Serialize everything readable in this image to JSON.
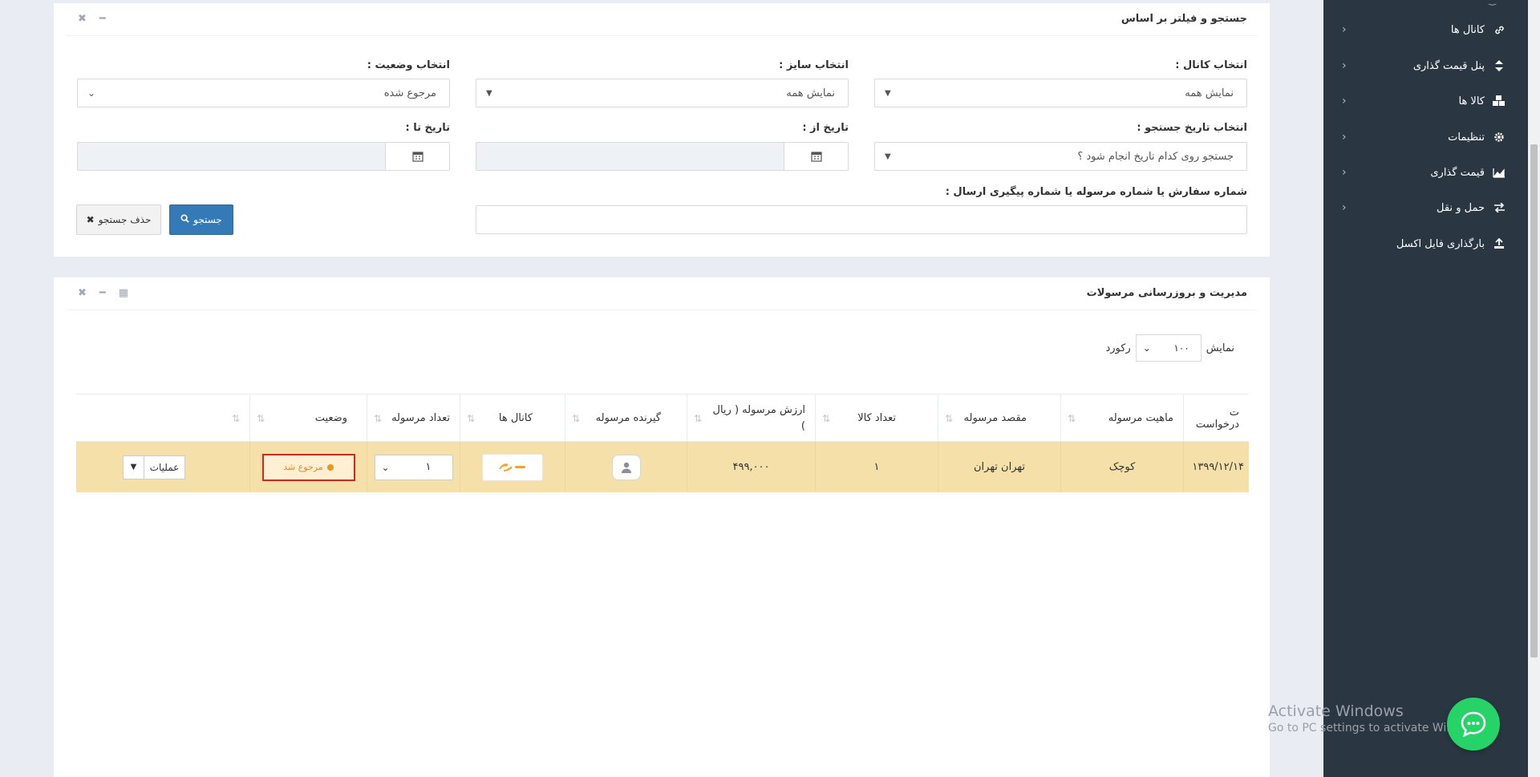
{
  "sidebar": {
    "items": [
      {
        "label": "کانال ها",
        "icon": "link-icon"
      },
      {
        "label": "پنل قیمت گذاری",
        "icon": "sort-icon"
      },
      {
        "label": "کالا ها",
        "icon": "cubes-icon"
      },
      {
        "label": "تنظیمات",
        "icon": "gear-icon"
      },
      {
        "label": "قیمت گذاری",
        "icon": "area-chart-icon"
      },
      {
        "label": "حمل و نقل",
        "icon": "exchange-icon"
      },
      {
        "label": "بارگذاری فایل اکسل",
        "icon": "upload-icon"
      }
    ],
    "chevron": "‹"
  },
  "search_panel": {
    "title": "جستجو و فیلتر بر اساس",
    "channel": {
      "label": "انتخاب کانال :",
      "value": "نمایش همه"
    },
    "size": {
      "label": "انتخاب سایز :",
      "value": "نمایش همه"
    },
    "status": {
      "label": "انتخاب وضعیت :",
      "value": "مرجوع شده"
    },
    "date_search": {
      "label": "انتخاب تاریخ جستجو :",
      "value": "جستجو روی کدام تاریخ انجام شود ؟"
    },
    "date_from": {
      "label": "تاریخ از :"
    },
    "date_to": {
      "label": "تاریخ تا :"
    },
    "order_number": {
      "label": "شماره سفارش یا شماره مرسوله یا شماره پیگیری ارسال :",
      "value": ""
    },
    "search_button": "جستجو",
    "clear_button": "حذف جستجو"
  },
  "manage_panel": {
    "title": "مدیریت و بروزرسانی مرسولات",
    "show_label": "نمایش",
    "page_size": "۱۰۰",
    "records_label": "رکورد",
    "columns": [
      "ت درخواست",
      "ماهیت مرسوله",
      "مقصد مرسوله",
      "تعداد کالا",
      "ارزش مرسوله ( ریال )",
      "گیرنده مرسوله",
      "کانال ها",
      "تعداد مرسوله",
      "وضعیت",
      ""
    ],
    "row": {
      "date": "۱۳۹۹/۱۲/۱۴",
      "nature": "کوچک",
      "destination": "تهران تهران",
      "item_count": "۱",
      "value": "۴۹۹,۰۰۰",
      "channel_logo": "logo",
      "shipment_count": "۱",
      "status": "مرجوع شد",
      "operations": "عملیات"
    }
  },
  "watermark": {
    "line1": "Activate Windows",
    "line2": "Go to PC settings to activate Windows."
  },
  "colors": {
    "sidebar_bg": "#2b3643",
    "row_highlight": "#f4e0a8",
    "primary": "#337ab7",
    "status_border": "#e0231a",
    "chat_green": "#25d366"
  }
}
